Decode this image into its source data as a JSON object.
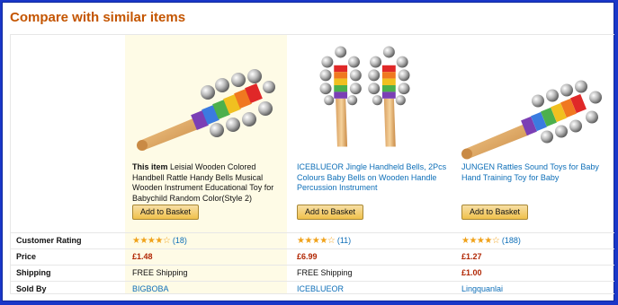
{
  "section_title": "Compare with similar items",
  "products": [
    {
      "prefix": "This item",
      "title": "Leisial Wooden Colored Handbell Rattle Handy Bells Musical Wooden Instrument Educational Toy for Babychild Random Color(Style 2)",
      "button": "Add to Basket",
      "stars": "★★★★☆",
      "rating_count": "(18)",
      "price": "£1.48",
      "shipping": "FREE Shipping",
      "sold_by": "BIGBOBA"
    },
    {
      "prefix": "",
      "title": "ICEBLUEOR Jingle Handheld Bells, 2Pcs Colours Baby Bells on Wooden Handle Percussion Instrument",
      "button": "Add to Basket",
      "stars": "★★★★☆",
      "rating_count": "(11)",
      "price": "£6.99",
      "shipping": "FREE Shipping",
      "sold_by": "ICEBLUEOR"
    },
    {
      "prefix": "",
      "title": "JUNGEN Rattles Sound Toys for Baby Hand Training Toy for Baby",
      "button": "Add to Basket",
      "stars": "★★★★☆",
      "rating_count": "(188)",
      "price": "£1.27",
      "shipping": "£1.00",
      "sold_by": "Lingquanlai"
    }
  ],
  "rows": {
    "rating": "Customer Rating",
    "price": "Price",
    "shipping": "Shipping",
    "sold_by": "Sold By"
  }
}
